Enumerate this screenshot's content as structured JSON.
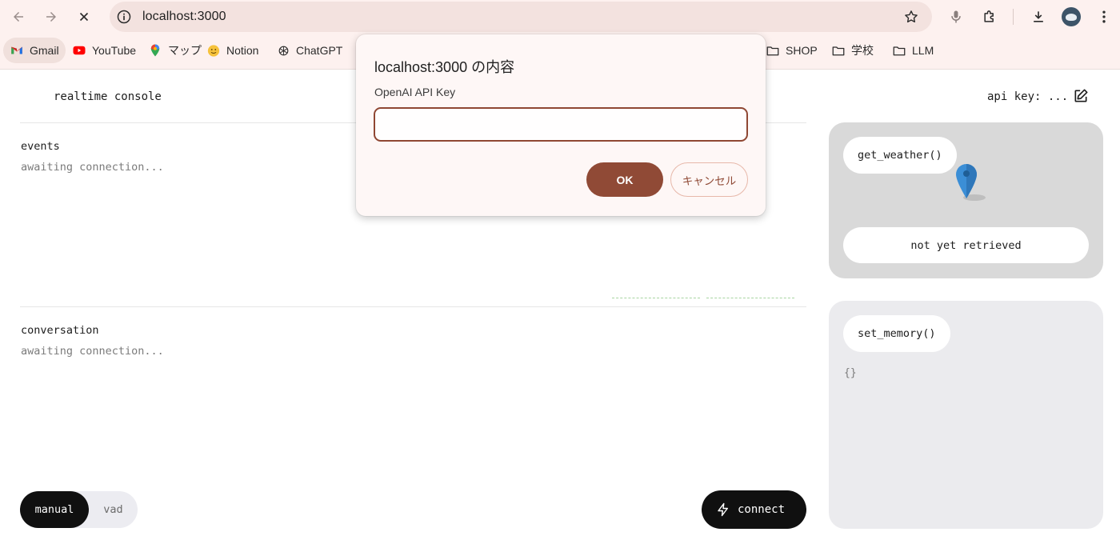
{
  "browser": {
    "url": "localhost:3000",
    "bookmarks": [
      {
        "label": "Gmail",
        "icon": "gmail-icon"
      },
      {
        "label": "YouTube",
        "icon": "youtube-icon"
      },
      {
        "label": "マップ",
        "icon": "maps-icon"
      },
      {
        "label": "Notion",
        "icon": "notion-icon"
      },
      {
        "label": "ChatGPT",
        "icon": "chatgpt-icon"
      },
      {
        "label": "SHOP",
        "icon": "folder-icon"
      },
      {
        "label": "学校",
        "icon": "folder-icon"
      },
      {
        "label": "LLM",
        "icon": "folder-icon"
      }
    ]
  },
  "app": {
    "title": "realtime console",
    "api_key_label": "api key: ...",
    "events": {
      "label": "events",
      "status": "awaiting connection..."
    },
    "conversation": {
      "label": "conversation",
      "status": "awaiting connection..."
    },
    "mode": {
      "active": "manual",
      "inactive": "vad"
    },
    "connect_label": "connect",
    "weather": {
      "tag": "get_weather()",
      "status": "not yet retrieved"
    },
    "memory": {
      "tag": "set_memory()",
      "content": "{}"
    }
  },
  "dialog": {
    "title": "localhost:3000 の内容",
    "message": "OpenAI API Key",
    "input_value": "",
    "ok_label": "OK",
    "cancel_label": "キャンセル"
  },
  "colors": {
    "accent": "#904a36",
    "chrome_bg": "#fdf1ef",
    "dark_button": "#101010",
    "visualization": "#a8d5a2"
  }
}
